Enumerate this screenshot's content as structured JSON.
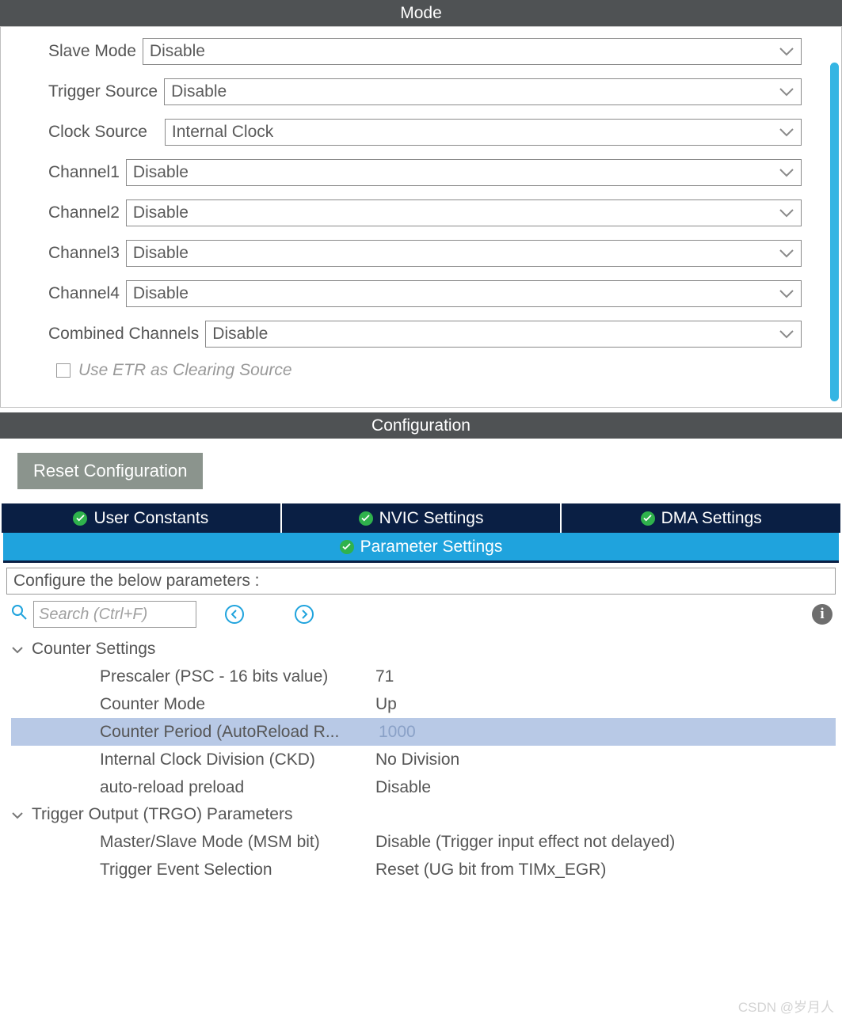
{
  "mode": {
    "title": "Mode",
    "rows": [
      {
        "label": "Slave Mode",
        "value": "Disable"
      },
      {
        "label": "Trigger Source",
        "value": "Disable"
      },
      {
        "label": "Clock Source",
        "value": "Internal Clock"
      },
      {
        "label": "Channel1",
        "value": "Disable"
      },
      {
        "label": "Channel2",
        "value": "Disable"
      },
      {
        "label": "Channel3",
        "value": "Disable"
      },
      {
        "label": "Channel4",
        "value": "Disable"
      },
      {
        "label": "Combined Channels",
        "value": "Disable"
      }
    ],
    "etr_label": "Use ETR as Clearing Source"
  },
  "config": {
    "title": "Configuration",
    "reset_label": "Reset Configuration",
    "tabs": {
      "user_constants": "User Constants",
      "nvic": "NVIC Settings",
      "dma": "DMA Settings",
      "param": "Parameter Settings"
    },
    "configure_prompt": "Configure the below parameters :",
    "search_placeholder": "Search (Ctrl+F)",
    "groups": {
      "counter": {
        "title": "Counter Settings",
        "items": [
          {
            "name": "Prescaler (PSC - 16 bits value)",
            "value": "71"
          },
          {
            "name": "Counter Mode",
            "value": "Up"
          },
          {
            "name": "Counter Period (AutoReload R...",
            "value": "1000",
            "selected": true
          },
          {
            "name": "Internal Clock Division (CKD)",
            "value": "No Division"
          },
          {
            "name": "auto-reload preload",
            "value": "Disable"
          }
        ]
      },
      "trgo": {
        "title": "Trigger Output (TRGO) Parameters",
        "items": [
          {
            "name": "Master/Slave Mode (MSM bit)",
            "value": "Disable (Trigger input effect not delayed)"
          },
          {
            "name": "Trigger Event Selection",
            "value": "Reset (UG bit from TIMx_EGR)"
          }
        ]
      }
    }
  },
  "watermark": "CSDN @岁月人"
}
